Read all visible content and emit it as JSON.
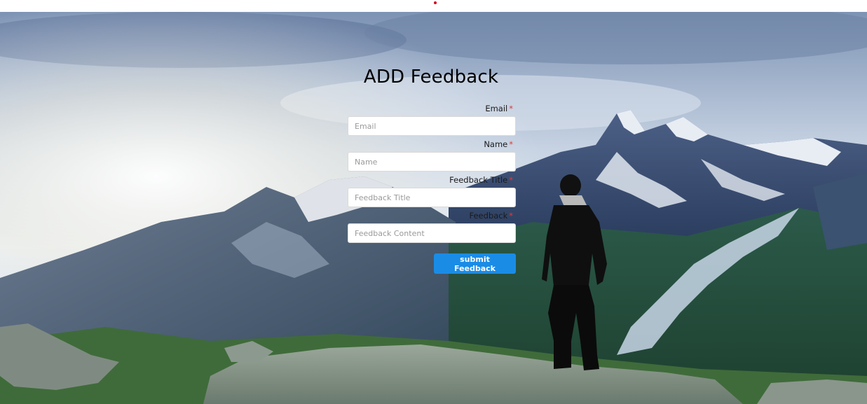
{
  "page": {
    "title": "ADD Feedback"
  },
  "form": {
    "fields": [
      {
        "label": "Email",
        "required_mark": "*",
        "placeholder": "Email",
        "value": ""
      },
      {
        "label": "Name",
        "required_mark": "*",
        "placeholder": "Name",
        "value": ""
      },
      {
        "label": "Feedback Title",
        "required_mark": "*",
        "placeholder": "Feedback Title",
        "value": ""
      },
      {
        "label": "Feedback",
        "required_mark": "*",
        "placeholder": "Feedback Content",
        "value": ""
      }
    ],
    "submit_label": "submit Feedback"
  },
  "colors": {
    "primary_button": "#1a8ce6",
    "required_mark": "#e03a3a",
    "top_indicator": "#d0021b"
  }
}
